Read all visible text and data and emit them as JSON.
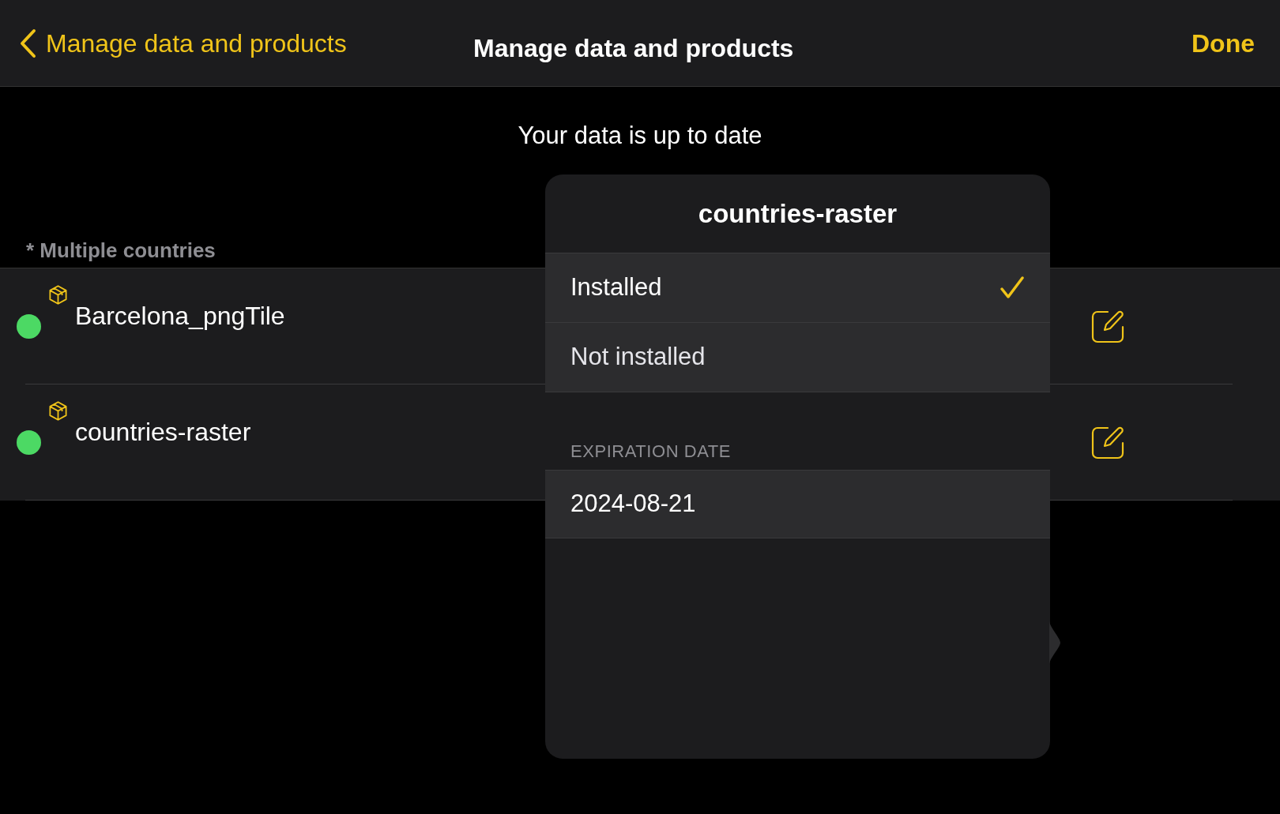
{
  "nav": {
    "back_label": "Manage data and products",
    "title": "Manage data and products",
    "done": "Done"
  },
  "status": "Your data is up to date",
  "section": {
    "header": "* Multiple countries",
    "rows": [
      {
        "name": "Barcelona_pngTile",
        "color": "#4cd964"
      },
      {
        "name": "countries-raster",
        "color": "#4cd964"
      }
    ]
  },
  "popover": {
    "title": "countries-raster",
    "options": [
      {
        "label": "Installed",
        "selected": true
      },
      {
        "label": "Not installed",
        "selected": false
      }
    ],
    "section_header": "EXPIRATION DATE",
    "date": "2024-08-21"
  }
}
